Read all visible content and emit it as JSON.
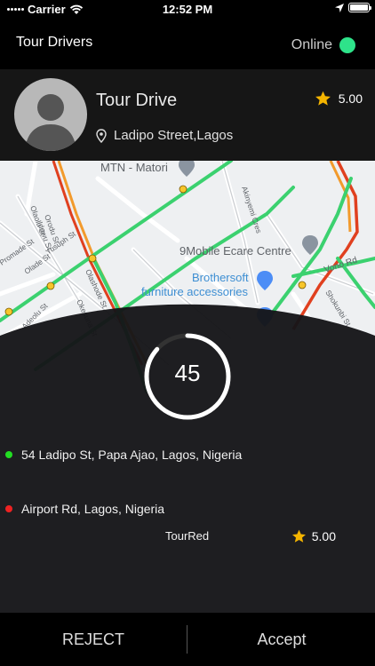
{
  "status_bar": {
    "carrier": "Carrier",
    "time": "12:52 PM"
  },
  "nav": {
    "title": "Tour Drivers",
    "online_label": "Online",
    "online_color": "#2ee38a"
  },
  "driver": {
    "name": "Tour Drive",
    "location": "Ladipo Street,Lagos",
    "rating": "5.00"
  },
  "map_labels": {
    "mtn": "MTN - Matori",
    "ninemobile": "9Mobile Ecare Centre",
    "brothersoft_1": "Brothersoft",
    "brothersoft_2": "furniture accessories",
    "vono": "Vono Rd",
    "akinyemi": "Akinyemi Cres",
    "streets": [
      "Orodu St",
      "Olaolu St",
      "Idowu St",
      "Ogunlana St",
      "Segun St",
      "Olashode St",
      "Yusuph St",
      "Adeolu St",
      "Okesuna St",
      "Shokunbi St",
      "Olade St",
      "Promade St"
    ]
  },
  "request": {
    "countdown": "45",
    "pickup": "54 Ladipo St, Papa Ajao, Lagos, Nigeria",
    "pickup_color": "#22dd22",
    "dropoff": "Airport Rd, Lagos, Nigeria",
    "dropoff_color": "#ee2222",
    "passenger": "TourRed",
    "passenger_rating": "5.00"
  },
  "actions": {
    "reject": "REJECT",
    "accept": "Accept"
  }
}
